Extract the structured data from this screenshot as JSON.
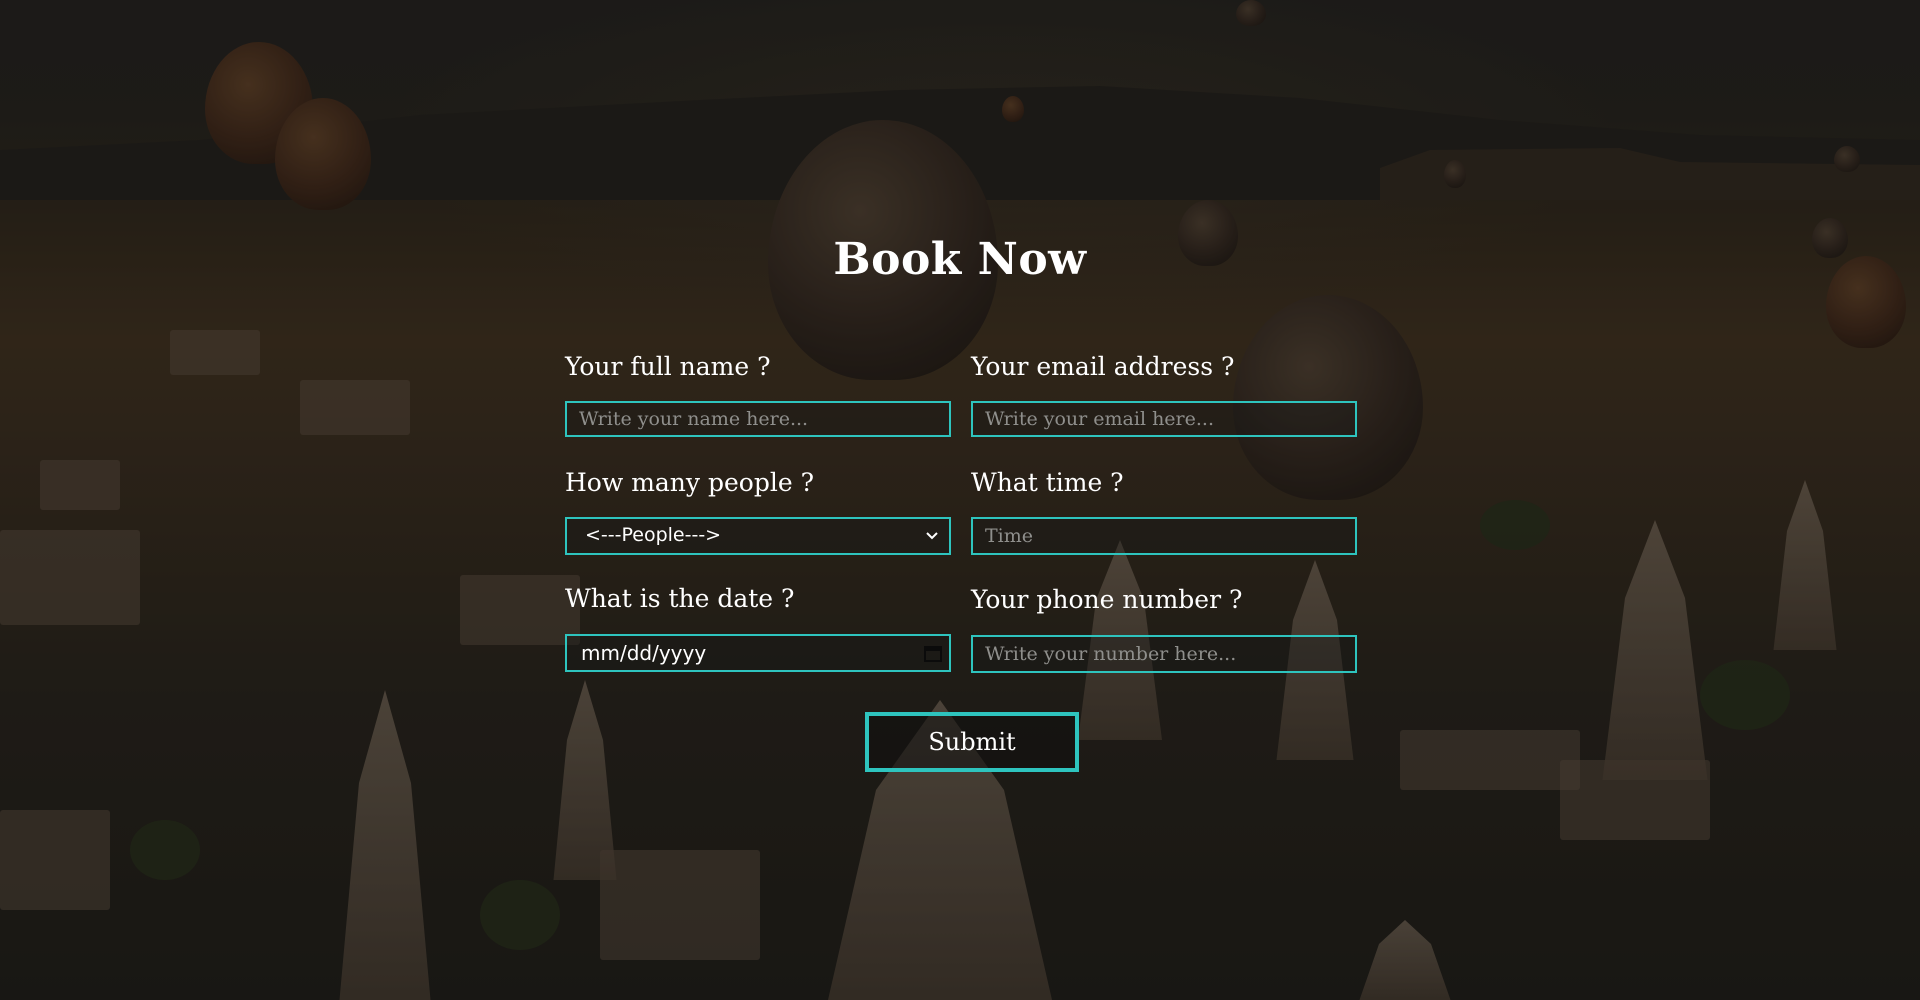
{
  "form": {
    "title": "Book Now",
    "name_label": "Your full name ?",
    "name_placeholder": "Write your name here...",
    "email_label": "Your email address ?",
    "email_placeholder": "Write your email here...",
    "people_label": "How many people ?",
    "people_selected": "<---People--->",
    "time_label": "What time ?",
    "time_placeholder": "Time",
    "date_label": "What is the date ?",
    "date_value": "mm/dd/yyyy",
    "phone_label": "Your phone number ?",
    "phone_placeholder": "Write your number here...",
    "submit_label": "Submit"
  },
  "colors": {
    "accent": "#2ec4be",
    "text": "#ffffff"
  },
  "icons": {
    "people_dropdown": "chevron-down-icon",
    "date_picker": "calendar-icon"
  }
}
